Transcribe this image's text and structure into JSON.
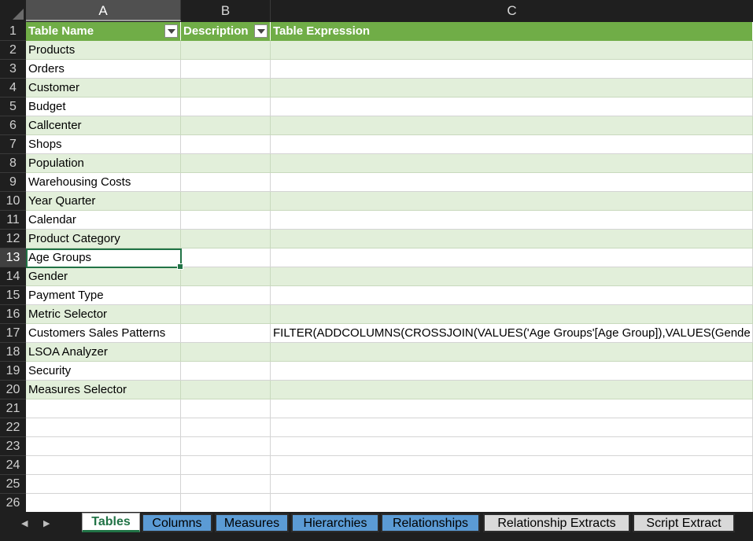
{
  "columns": [
    "A",
    "B",
    "C"
  ],
  "table": {
    "headers": [
      "Table Name",
      "Description",
      "Table Expression"
    ],
    "rows": [
      {
        "num": "2",
        "name": "Products",
        "desc": "",
        "expr": ""
      },
      {
        "num": "3",
        "name": "Orders",
        "desc": "",
        "expr": ""
      },
      {
        "num": "4",
        "name": "Customer",
        "desc": "",
        "expr": ""
      },
      {
        "num": "5",
        "name": "Budget",
        "desc": "",
        "expr": ""
      },
      {
        "num": "6",
        "name": "Callcenter",
        "desc": "",
        "expr": ""
      },
      {
        "num": "7",
        "name": "Shops",
        "desc": "",
        "expr": ""
      },
      {
        "num": "8",
        "name": "Population",
        "desc": "",
        "expr": ""
      },
      {
        "num": "9",
        "name": "Warehousing Costs",
        "desc": "",
        "expr": ""
      },
      {
        "num": "10",
        "name": "Year Quarter",
        "desc": "",
        "expr": ""
      },
      {
        "num": "11",
        "name": "Calendar",
        "desc": "",
        "expr": ""
      },
      {
        "num": "12",
        "name": "Product Category",
        "desc": "",
        "expr": ""
      },
      {
        "num": "13",
        "name": "Age Groups",
        "desc": "",
        "expr": ""
      },
      {
        "num": "14",
        "name": "Gender",
        "desc": "",
        "expr": ""
      },
      {
        "num": "15",
        "name": "Payment Type",
        "desc": "",
        "expr": ""
      },
      {
        "num": "16",
        "name": "Metric Selector",
        "desc": "",
        "expr": ""
      },
      {
        "num": "17",
        "name": "Customers Sales Patterns",
        "desc": "",
        "expr": "FILTER(ADDCOLUMNS(CROSSJOIN(VALUES('Age Groups'[Age Group]),VALUES(Gende"
      },
      {
        "num": "18",
        "name": "LSOA Analyzer",
        "desc": "",
        "expr": ""
      },
      {
        "num": "19",
        "name": "Security",
        "desc": "",
        "expr": ""
      },
      {
        "num": "20",
        "name": "Measures Selector",
        "desc": "",
        "expr": ""
      }
    ],
    "empty_rows": [
      "21",
      "22",
      "23",
      "24",
      "25",
      "26"
    ]
  },
  "header_row_num": "1",
  "active_cell": "A13",
  "sheet_tabs": [
    {
      "label": "Tables",
      "style": "active"
    },
    {
      "label": "Columns",
      "style": "blue"
    },
    {
      "label": "Measures",
      "style": "blue"
    },
    {
      "label": "Hierarchies",
      "style": "blue"
    },
    {
      "label": "Relationships",
      "style": "blue"
    },
    {
      "label": "Relationship Extracts",
      "style": "gray"
    },
    {
      "label": "Script Extract",
      "style": "gray"
    }
  ],
  "colors": {
    "header_green": "#70ad47",
    "band_green": "#e2efda",
    "tab_blue": "#5b9bd5",
    "tab_gray": "#d9d9d9",
    "selection": "#217346"
  },
  "icons": {
    "nav_prev": "◀",
    "nav_next": "▶"
  }
}
